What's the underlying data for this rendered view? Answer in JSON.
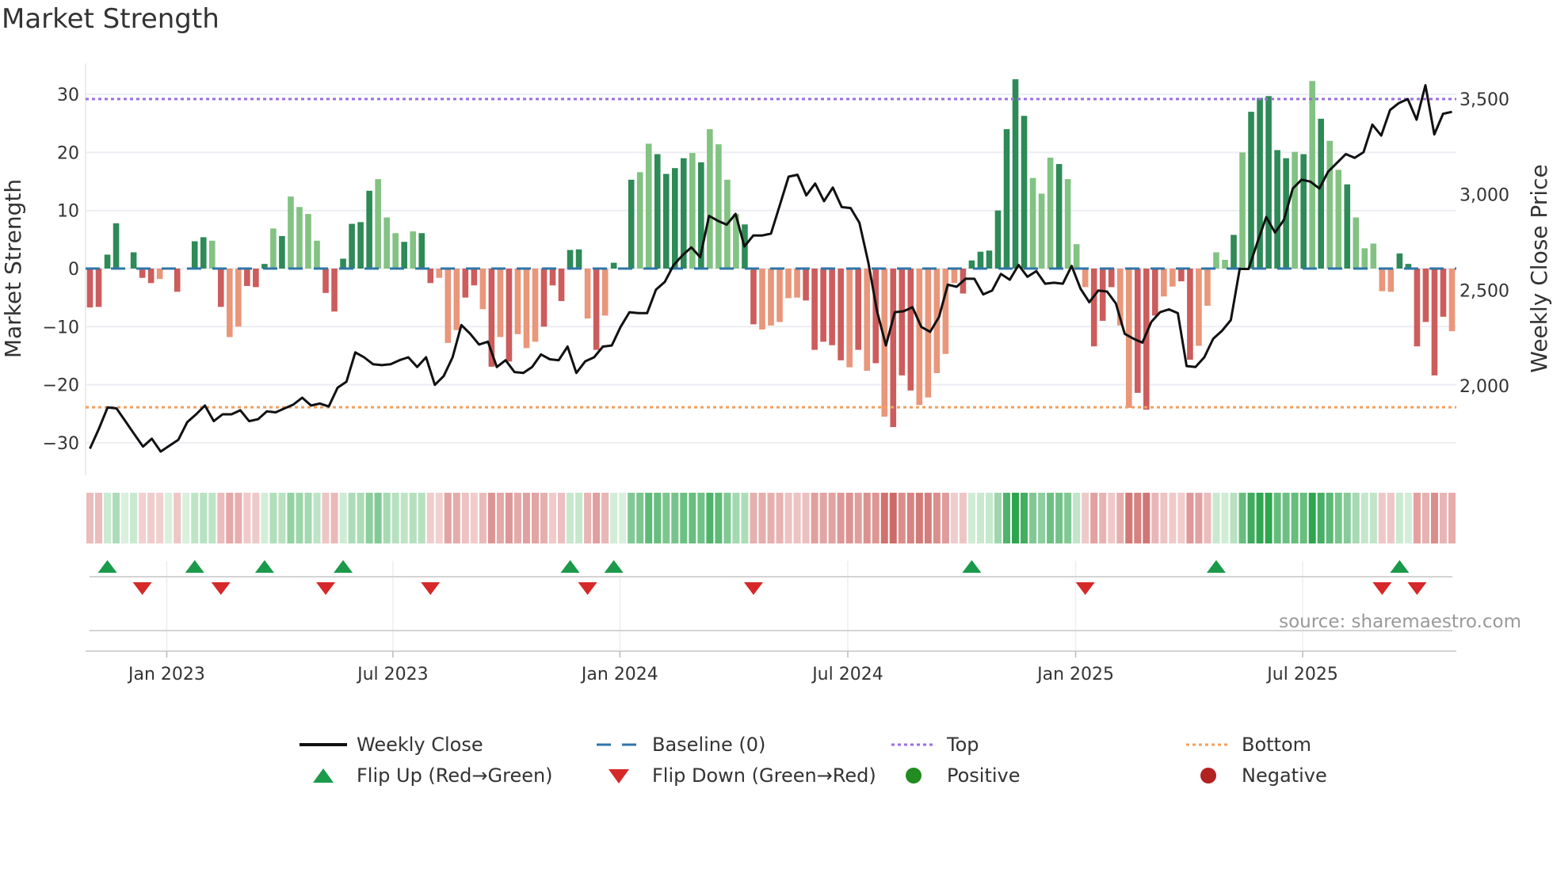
{
  "title": "Market Strength",
  "source": "source: sharemaestro.com",
  "colors": {
    "bar_pos_dark": "#2e8a56",
    "bar_pos_light": "#82c282",
    "bar_neg_dark": "#cd5c5c",
    "bar_neg_light": "#e9967a",
    "line": "#111111",
    "baseline": "#2f75a8",
    "top": "#9b6ee0",
    "bottom": "#f0a060",
    "flip_up": "#1a9a4a",
    "flip_down": "#d62828",
    "positive": "#228b22",
    "negative": "#b22222"
  },
  "chart_data": {
    "type": "bar+line",
    "title": "Market Strength",
    "ylabel": "Market Strength",
    "y2label": "Weekly Close Price",
    "ylim": [
      -38,
      35
    ],
    "y2lim": [
      1640,
      3660
    ],
    "yticks": [
      "30",
      "20",
      "10",
      "0",
      "−10",
      "−20",
      "−30"
    ],
    "ytick_values": [
      30,
      20,
      10,
      0,
      -10,
      -20,
      -30
    ],
    "y2ticks": [
      "3,500",
      "3,000",
      "2,500",
      "2,000"
    ],
    "y2tick_values": [
      3500,
      3000,
      2500,
      2000
    ],
    "xticks": [
      {
        "label": "Jan 2023",
        "week": 8.8
      },
      {
        "label": "Jul 2023",
        "week": 34.7
      },
      {
        "label": "Jan 2024",
        "week": 60.7
      },
      {
        "label": "Jul 2024",
        "week": 86.8
      },
      {
        "label": "Jan 2025",
        "week": 112.9
      },
      {
        "label": "Jul 2025",
        "week": 138.9
      }
    ],
    "weeks": 157,
    "top_level": 29.2,
    "bottom_level": -23.9,
    "baseline": 0,
    "strength": [
      -6.7,
      -6.6,
      2.4,
      7.8,
      0,
      2.8,
      -1.6,
      -2.5,
      -1.8,
      0,
      -4,
      0,
      4.7,
      5.4,
      4.8,
      -6.6,
      -11.8,
      -10,
      -3,
      -3.2,
      0.8,
      6.9,
      5.6,
      12.4,
      10.6,
      9.4,
      4.8,
      -4.2,
      -7.4,
      1.7,
      7.7,
      8,
      13.4,
      15.4,
      8.8,
      6.1,
      4.6,
      6.4,
      6.1,
      -2.5,
      -1.6,
      -12.8,
      -10.6,
      -5,
      -2.9,
      -7,
      -16.9,
      -11.8,
      -16,
      -11.3,
      -13.7,
      -12.6,
      -10,
      -2.9,
      -5.6,
      3.2,
      3.3,
      -8.6,
      -14,
      -8.1,
      1,
      0.1,
      15.3,
      16.6,
      21.5,
      19.7,
      16.3,
      17.3,
      19,
      19.9,
      18.3,
      24,
      21.4,
      15.3,
      9.4,
      7.6,
      -9.6,
      -10.5,
      -9.8,
      -9.2,
      -5.1,
      -5,
      -5.5,
      -14,
      -12.6,
      -13.2,
      -15.8,
      -17,
      -14,
      -17.6,
      -16.3,
      -25.5,
      -27.3,
      -18.4,
      -21,
      -23.5,
      -22.2,
      -18,
      -14.7,
      -2.5,
      -4.3,
      1.4,
      2.9,
      3.1,
      10,
      24,
      32.6,
      26.3,
      15.6,
      12.9,
      19.1,
      18,
      15.4,
      4.2,
      -3.2,
      -13.4,
      -9,
      -3.2,
      -9.8,
      -24,
      -21.4,
      -24.3,
      -8.1,
      -4.8,
      -3.1,
      -2.2,
      -15.7,
      -13.3,
      -6.4,
      2.8,
      1.5,
      5.8,
      20,
      27,
      29.4,
      29.7,
      20.4,
      19,
      20.1,
      19.7,
      32.3,
      25.8,
      22,
      17,
      14.5,
      8.8,
      3.5,
      4.3,
      -3.9,
      -4,
      2.6,
      0.8,
      -13.4,
      -9.2,
      -18.4,
      -8.3,
      -10.8
    ],
    "shade": "ddddddddldddddldlldddldllllddddddllldlddlllddldldllldddddldldddllddddldllllddllllldddddldldldddlllllddddddddllldllldddlldddllddlllldldddddldldlldlllllddddddldldld",
    "weekly_close": [
      1671,
      1774,
      1887,
      1882,
      1815,
      1748,
      1682,
      1723,
      1656,
      1687,
      1718,
      1810,
      1851,
      1897,
      1815,
      1851,
      1851,
      1872,
      1815,
      1825,
      1866,
      1861,
      1882,
      1902,
      1938,
      1897,
      1907,
      1892,
      1990,
      2021,
      2175,
      2149,
      2113,
      2108,
      2113,
      2134,
      2149,
      2098,
      2149,
      2005,
      2051,
      2149,
      2318,
      2272,
      2216,
      2231,
      2098,
      2134,
      2072,
      2067,
      2098,
      2164,
      2139,
      2134,
      2205,
      2067,
      2128,
      2149,
      2205,
      2211,
      2308,
      2385,
      2380,
      2380,
      2503,
      2544,
      2632,
      2683,
      2724,
      2673,
      2889,
      2863,
      2843,
      2899,
      2729,
      2786,
      2786,
      2796,
      2945,
      3094,
      3104,
      2996,
      3058,
      2966,
      3037,
      2935,
      2930,
      2853,
      2647,
      2390,
      2211,
      2385,
      2390,
      2411,
      2308,
      2282,
      2360,
      2529,
      2518,
      2560,
      2560,
      2478,
      2498,
      2585,
      2555,
      2632,
      2570,
      2600,
      2534,
      2539,
      2534,
      2627,
      2508,
      2437,
      2498,
      2493,
      2431,
      2272,
      2246,
      2226,
      2334,
      2385,
      2400,
      2380,
      2103,
      2098,
      2149,
      2246,
      2288,
      2344,
      2611,
      2611,
      2750,
      2883,
      2801,
      2868,
      3032,
      3078,
      3068,
      3032,
      3120,
      3166,
      3212,
      3192,
      3222,
      3366,
      3309,
      3443,
      3479,
      3500,
      3392,
      3572,
      3315,
      3423,
      3433
    ],
    "flip_up_weeks": [
      2,
      12,
      20,
      29,
      55,
      60,
      101,
      129,
      150
    ],
    "flip_down_weeks": [
      6,
      15,
      27,
      39,
      57,
      76,
      114,
      148,
      152
    ],
    "legend": {
      "weekly_close": "Weekly Close",
      "baseline": "Baseline (0)",
      "top": "Top",
      "bottom": "Bottom",
      "flip_up": "Flip Up (Red→Green)",
      "flip_down": "Flip Down (Green→Red)",
      "positive": "Positive",
      "negative": "Negative"
    },
    "legend_position": "bottom"
  }
}
